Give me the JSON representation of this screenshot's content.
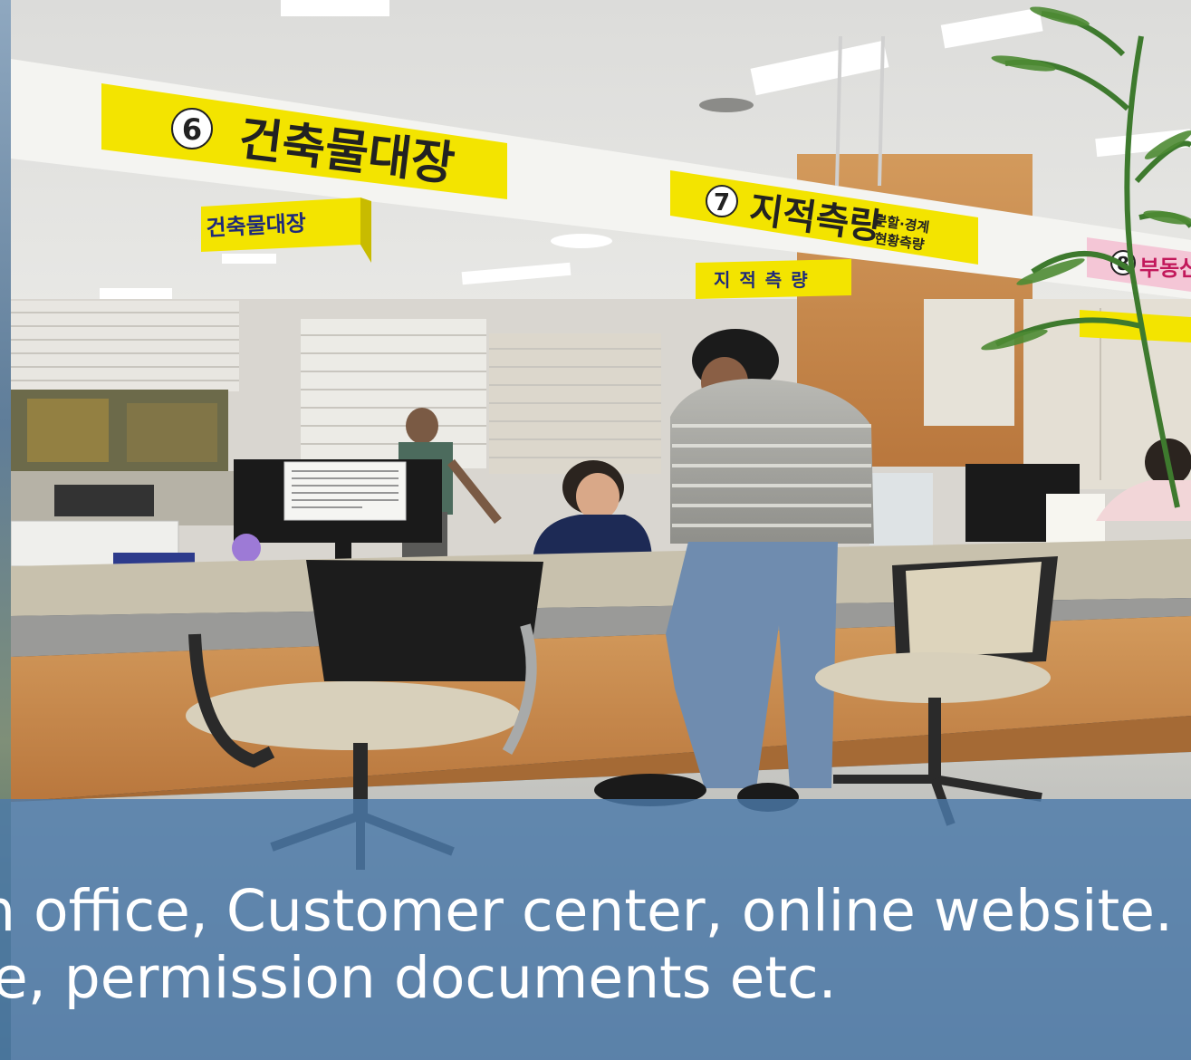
{
  "signs": {
    "counter6": {
      "number": "6",
      "title": "건축물대장"
    },
    "counter6_hanging": "건축물대장",
    "counter7": {
      "number": "7",
      "title": "지적측량",
      "sub1": "분할·경계",
      "sub2": "현황측량"
    },
    "counter7_hanging": "지적측량",
    "counter8": {
      "number": "8",
      "title": "부동산"
    }
  },
  "caption": {
    "line1": "anch office, Customer center, online website.",
    "line2": "e, permission documents etc."
  },
  "colors": {
    "sign_yellow": "#f3e400",
    "sign_pink": "#f4c6d6",
    "caption_overlay": "#4c7aaa",
    "counter_wood": "#c98a4c"
  }
}
